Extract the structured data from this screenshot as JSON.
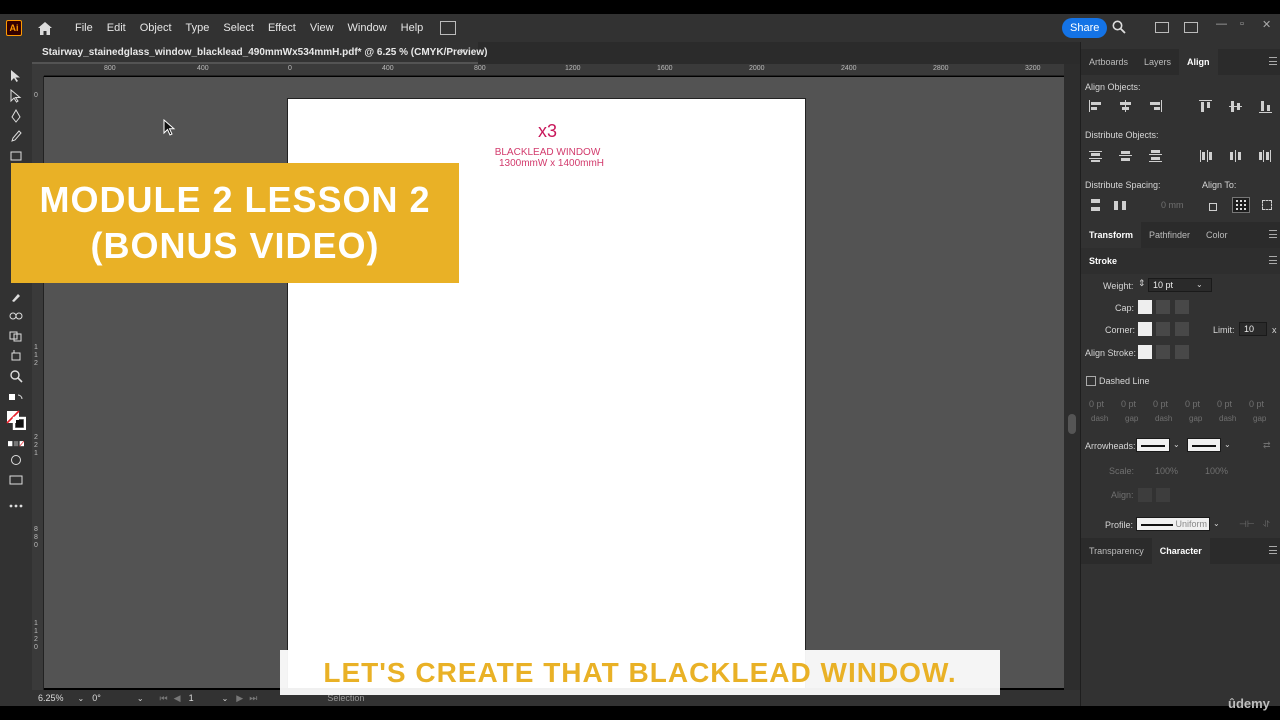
{
  "app": {
    "logo": "Ai"
  },
  "menu": {
    "items": [
      "File",
      "Edit",
      "Object",
      "Type",
      "Select",
      "Effect",
      "View",
      "Window",
      "Help"
    ],
    "share_label": "Share"
  },
  "document": {
    "tab_title": "Stairway_stainedglass_window_blacklead_490mmWx534mmH.pdf* @ 6.25 % (CMYK/Preview)",
    "close": "×"
  },
  "ruler": {
    "h_ticks": [
      "800",
      "400",
      "0",
      "400",
      "800",
      "1200",
      "1600",
      "2000",
      "2400",
      "2800",
      "3200"
    ],
    "v_ticks": [
      "0",
      "1",
      "1",
      "2",
      "2",
      "2",
      "1",
      "8",
      "8",
      "0",
      "1",
      "1",
      "2",
      "0",
      "0",
      "0",
      "1",
      "4",
      "0",
      "0"
    ]
  },
  "artboard": {
    "count": "x3",
    "line1": "BLACKLEAD WINDOW",
    "line2": "1300mmW  x 1400mmH"
  },
  "status": {
    "zoom": "6.25%",
    "rotation": "0°",
    "artboard_num": "1",
    "tool": "Selection"
  },
  "overlay": {
    "banner_line1": "MODULE 2 LESSON 2",
    "banner_line2": "(BONUS VIDEO)",
    "caption": "LET'S CREATE THAT BLACKLEAD WINDOW.",
    "watermark": "ûdemy"
  },
  "panel": {
    "tabs_top": [
      "Artboards",
      "Layers",
      "Align"
    ],
    "align_objects": "Align Objects:",
    "distribute_objects": "Distribute Objects:",
    "distribute_spacing": "Distribute Spacing:",
    "align_to": "Align To:",
    "spacing_value": "0 mm",
    "tabs_mid": [
      "Transform",
      "Pathfinder",
      "Color"
    ],
    "stroke_title": "Stroke",
    "weight_label": "Weight:",
    "weight_value": "10 pt",
    "cap_label": "Cap:",
    "corner_label": "Corner:",
    "limit_label": "Limit:",
    "limit_value": "10",
    "limit_x": "x",
    "align_stroke_label": "Align Stroke:",
    "dashed_line": "Dashed Line",
    "dash_values": [
      "0 pt",
      "0 pt",
      "0 pt",
      "0 pt",
      "0 pt",
      "0 pt"
    ],
    "dash_labels": [
      "dash",
      "gap",
      "dash",
      "gap",
      "dash",
      "gap"
    ],
    "arrowheads_label": "Arrowheads:",
    "scale_label": "Scale:",
    "scale_values": [
      "100%",
      "100%"
    ],
    "align_label": "Align:",
    "profile_label": "Profile:",
    "profile_value": "Uniform",
    "tabs_bottom": [
      "Transparency",
      "Character"
    ]
  }
}
